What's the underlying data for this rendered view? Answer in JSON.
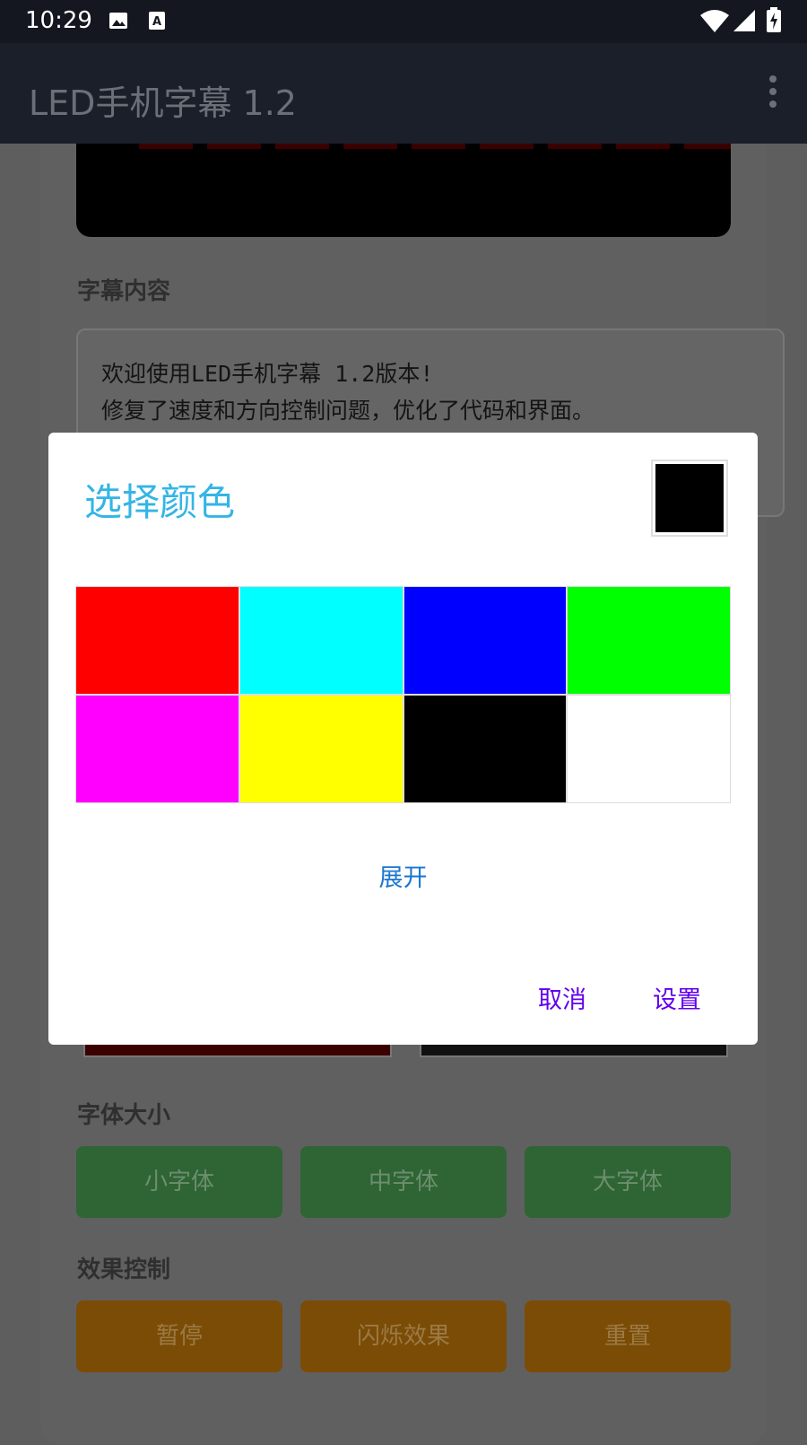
{
  "status_bar": {
    "time": "10:29",
    "icons": [
      "image-icon",
      "font-icon",
      "wifi-icon",
      "signal-icon",
      "battery-charging-icon"
    ]
  },
  "app_bar": {
    "title": "LED手机字幕 1.2",
    "menu_icon": "more-vert-icon"
  },
  "content": {
    "subtitle_section_label": "字幕内容",
    "subtitle_text_line1": "欢迎使用LED手机字幕 1.2版本!",
    "subtitle_text_line2": "修复了速度和方向控制问题，优化了代码和界面。",
    "font_size_label": "字体大小",
    "font_size_buttons": [
      "小字体",
      "中字体",
      "大字体"
    ],
    "effects_label": "效果控制",
    "effect_buttons": [
      "暂停",
      "闪烁效果",
      "重置"
    ]
  },
  "dialog": {
    "title": "选择颜色",
    "current_color": "#000000",
    "swatches": [
      "#ff0000",
      "#00ffff",
      "#0000ff",
      "#00ff00",
      "#ff00ff",
      "#ffff00",
      "#000000",
      "#ffffff"
    ],
    "expand_label": "展开",
    "cancel_label": "取消",
    "confirm_label": "设置"
  },
  "colors": {
    "title_accent": "#33b5e5",
    "action_accent": "#6200ee",
    "link_accent": "#1976d2",
    "green_button": "#2e7d32",
    "orange_button": "#f39c12"
  }
}
